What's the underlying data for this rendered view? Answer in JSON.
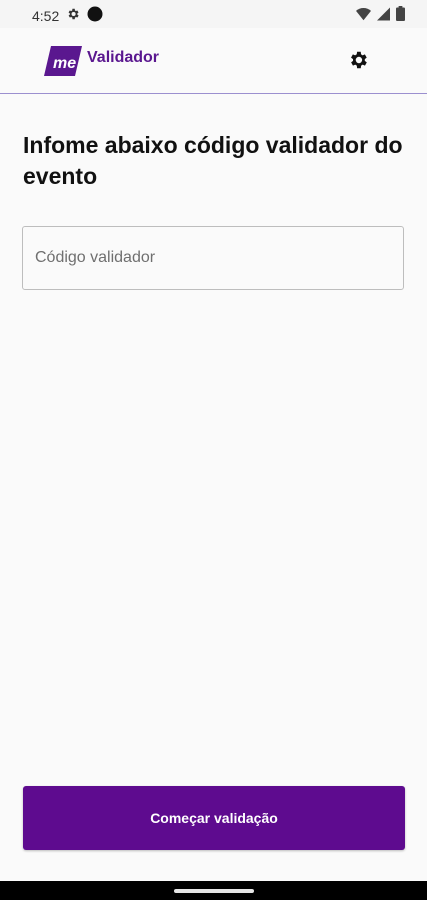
{
  "status_bar": {
    "time": "4:52",
    "left_icons": [
      "gear-icon",
      "record-dot-icon"
    ],
    "right_icons": [
      "wifi-icon",
      "signal-icon",
      "battery-icon"
    ]
  },
  "app_bar": {
    "logo_text": "me",
    "title": "Validador",
    "settings_icon": "gear-icon",
    "accent_color": "#5a178f"
  },
  "main": {
    "heading": "Infome abaixo código validador do evento",
    "code_input": {
      "placeholder": "Código validador",
      "value": ""
    },
    "start_button_label": "Começar validação",
    "button_color": "#5e0b8f"
  }
}
